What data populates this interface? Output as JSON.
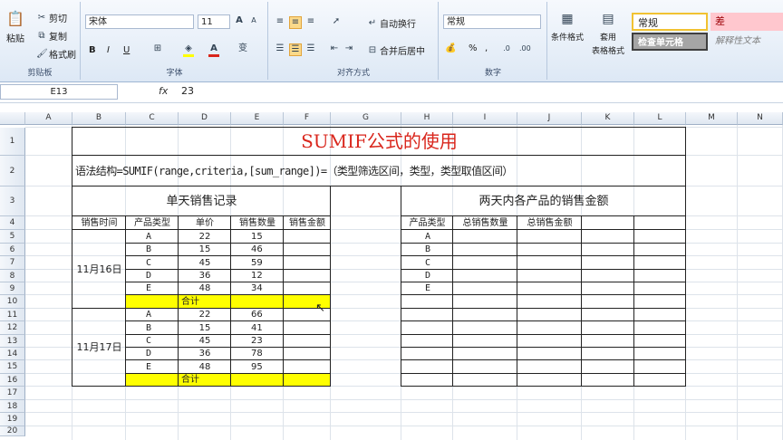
{
  "ribbon": {
    "clipboard": {
      "paste": "粘贴",
      "cut": "剪切",
      "copy": "复制",
      "format_painter": "格式刷",
      "group": "剪贴板"
    },
    "font": {
      "name": "宋体",
      "size": "11",
      "group": "字体",
      "bold": "B",
      "italic": "I",
      "underline": "U"
    },
    "alignment": {
      "wrap": "自动换行",
      "merge": "合并后居中",
      "group": "对齐方式"
    },
    "number": {
      "format": "常规",
      "percent": "%",
      "comma": ",",
      "group": "数字"
    },
    "styles": {
      "conditional": "条件格式",
      "table_format_1": "套用",
      "table_format_2": "表格格式",
      "normal": "常规",
      "bad": "差",
      "check_cell": "检查单元格",
      "explanatory": "解释性文本"
    }
  },
  "formula_bar": {
    "cell_ref": "E13",
    "fx": "fx",
    "value": "23"
  },
  "columns": [
    "A",
    "B",
    "C",
    "D",
    "E",
    "F",
    "G",
    "H",
    "I",
    "J",
    "K",
    "L",
    "M",
    "N"
  ],
  "rows": [
    "1",
    "2",
    "3",
    "4",
    "5",
    "6",
    "7",
    "8",
    "9",
    "10",
    "11",
    "12",
    "13",
    "14",
    "15",
    "16",
    "17",
    "18",
    "19",
    "20"
  ],
  "sheet": {
    "title": "SUMIF公式的使用",
    "syntax": "语法结构=SUMIF(range,criteria,[sum_range])=（类型筛选区间，类型，类型取值区间）",
    "left_title": "单天销售记录",
    "right_title": "两天内各产品的销售金额",
    "left_headers": [
      "销售时间",
      "产品类型",
      "单价",
      "销售数量",
      "销售金额"
    ],
    "right_headers": [
      "产品类型",
      "总销售数量",
      "总销售金额"
    ],
    "day1": "11月16日",
    "day2": "11月17日",
    "subtotal": "合计",
    "day1_rows": [
      [
        "A",
        "22",
        "15"
      ],
      [
        "B",
        "15",
        "46"
      ],
      [
        "C",
        "45",
        "59"
      ],
      [
        "D",
        "36",
        "12"
      ],
      [
        "E",
        "48",
        "34"
      ]
    ],
    "day2_rows": [
      [
        "A",
        "22",
        "66"
      ],
      [
        "B",
        "15",
        "41"
      ],
      [
        "C",
        "45",
        "23"
      ],
      [
        "D",
        "36",
        "78"
      ],
      [
        "E",
        "48",
        "95"
      ]
    ],
    "right_types": [
      "A",
      "B",
      "C",
      "D",
      "E"
    ]
  },
  "colors": {
    "title_red": "#d9261c",
    "highlight": "#ffff00",
    "bad_bg": "#ffc7ce",
    "bad_text": "#9c0006",
    "check_bg": "#a5a5a5"
  }
}
